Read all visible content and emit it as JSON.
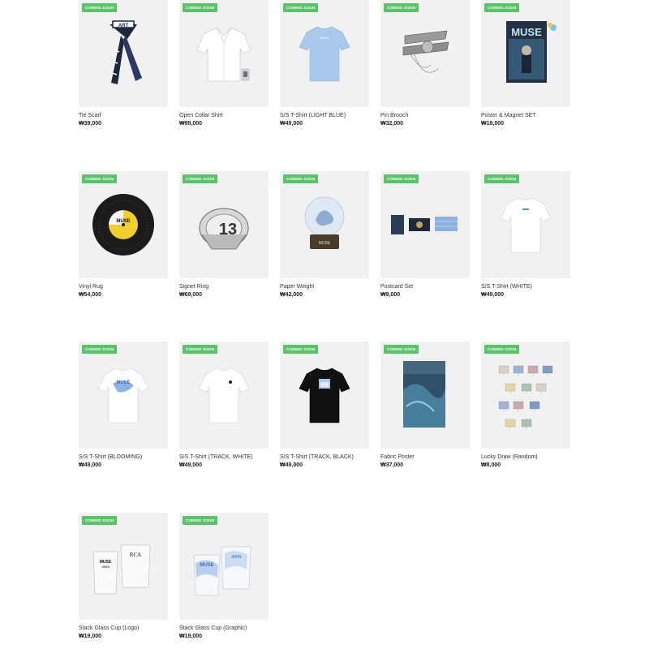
{
  "badge_label": "COMING SOON",
  "products": [
    {
      "name": "Tie Scarf",
      "price": "₩39,000",
      "icon": "tie-scarf-icon"
    },
    {
      "name": "Open Collar Shirt",
      "price": "₩99,000",
      "icon": "open-collar-shirt-icon"
    },
    {
      "name": "S/S T-Shirt (LIGHT BLUE)",
      "price": "₩49,000",
      "icon": "light-blue-tshirt-icon"
    },
    {
      "name": "Pin Brooch",
      "price": "₩32,000",
      "icon": "pin-brooch-icon"
    },
    {
      "name": "Poster & Magnet SET",
      "price": "₩18,000",
      "icon": "poster-magnet-icon",
      "art_text": "MUSE"
    },
    {
      "name": "Vinyl Rug",
      "price": "₩54,000",
      "icon": "vinyl-rug-icon",
      "art_text": "MUSE"
    },
    {
      "name": "Signet Ring",
      "price": "₩69,000",
      "icon": "signet-ring-icon",
      "art_text": "13"
    },
    {
      "name": "Paper Weight",
      "price": "₩42,000",
      "icon": "snow-globe-icon",
      "art_text": "MUSE"
    },
    {
      "name": "Postcard Set",
      "price": "₩9,000",
      "icon": "postcard-set-icon"
    },
    {
      "name": "S/S T-Shirt (WHITE)",
      "price": "₩49,000",
      "icon": "white-tshirt-icon"
    },
    {
      "name": "S/S T-Shirt (BLOOMING)",
      "price": "₩49,000",
      "icon": "blooming-tshirt-icon",
      "art_text": "MUSE"
    },
    {
      "name": "S/S T-Shirt (TRACK, WHITE)",
      "price": "₩49,000",
      "icon": "track-white-tshirt-icon"
    },
    {
      "name": "S/S T-Shirt (TRACK, BLACK)",
      "price": "₩49,000",
      "icon": "track-black-tshirt-icon"
    },
    {
      "name": "Fabric Poster",
      "price": "₩37,000",
      "icon": "fabric-poster-icon"
    },
    {
      "name": "Lucky Draw (Random)",
      "price": "₩8,000",
      "icon": "lucky-draw-icon"
    },
    {
      "name": "Stack Glass Cup (Logo)",
      "price": "₩19,000",
      "icon": "glass-cup-logo-icon",
      "art_text": [
        "MUSE",
        "JIMIN",
        "RCA"
      ]
    },
    {
      "name": "Stack Glass Cup (Graphic)",
      "price": "₩19,000",
      "icon": "glass-cup-graphic-icon",
      "art_text": [
        "MUSE",
        "JIMIN"
      ]
    }
  ],
  "colors": {
    "badge": "#5cc26a",
    "thumb_bg": "#f1f1f1",
    "light_blue": "#a9c9ec",
    "black": "#111111"
  }
}
